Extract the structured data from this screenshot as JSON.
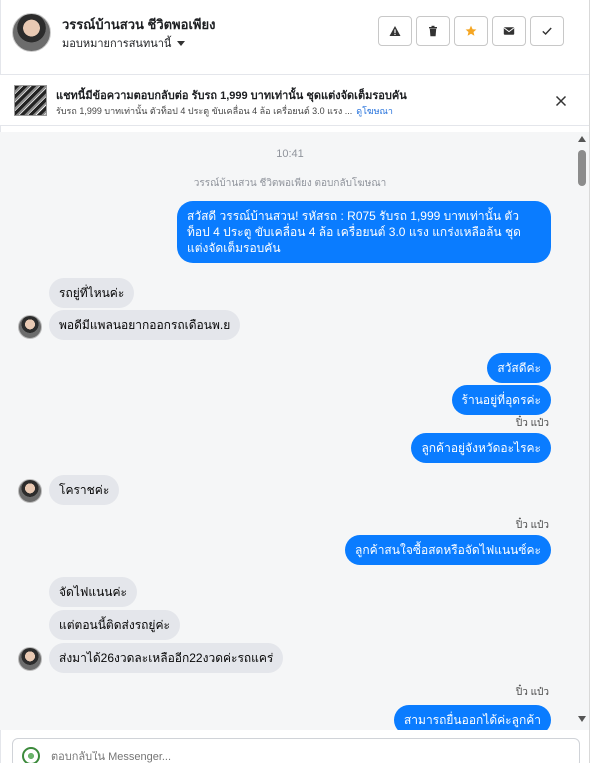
{
  "header": {
    "contact_name": "วรรณ์บ้านสวน ชีวิตพอเพียง",
    "assign_label": "มอบหมายการสนทนานี้",
    "actions": [
      {
        "name": "spam-report",
        "icon": "warning-icon"
      },
      {
        "name": "delete",
        "icon": "trash-icon"
      },
      {
        "name": "star",
        "icon": "star-icon",
        "color": "#f5a623"
      },
      {
        "name": "mark-unread",
        "icon": "envelope-icon"
      },
      {
        "name": "mark-done",
        "icon": "check-icon"
      }
    ]
  },
  "ad_banner": {
    "title": "แชทนี้มีข้อความตอบกลับต่อ รับรถ 1,999 บาทเท่านั้น ชุดแต่งจัดเต็มรอบคัน",
    "subtitle": "รับรถ 1,999 บาทเท่านั้น ตัวท็อป 4 ประตู ขับเคลื่อน 4 ล้อ เครื่อยนต์ 3.0 แรง ...",
    "link_label": "ดูโฆษณา"
  },
  "chat": {
    "timestamp": "10:41",
    "ad_reply_note": "วรรณ์บ้านสวน ชีวิตพอเพียง ตอบกลับโฆษณา",
    "messages": [
      {
        "dir": "out",
        "text": "สวัสดี วรรณ์บ้านสวน! รหัสรถ : R075 รับรถ 1,999 บาทเท่านั้น ตัวท็อป 4 ประตู ขับเคลื่อน 4 ล้อ  เครื่อยนต์ 3.0 แรง แกร่งเหลือล้น ชุดแต่งจัดเต็มรอบคัน"
      },
      {
        "dir": "in",
        "text": "รถยู่ที่ไหนค่ะ"
      },
      {
        "dir": "in",
        "text": "พอดีมีแพลนอยากออกรถเดือนพ.ย"
      },
      {
        "dir": "out",
        "text": "สวัสดีค่ะ"
      },
      {
        "dir": "out",
        "text": "ร้านอยู่ที่อุดรค่ะ"
      },
      {
        "dir": "seen",
        "text": "ปิ๋ว แป๋ว"
      },
      {
        "dir": "out",
        "text": "ลูกค้าอยู่จังหวัดอะไรคะ"
      },
      {
        "dir": "in",
        "text": "โคราชค่ะ"
      },
      {
        "dir": "seen",
        "text": "ปิ๋ว แป๋ว"
      },
      {
        "dir": "out",
        "text": "ลูกค้าสนใจซื้อสดหรือจัดไฟแนนซ์คะ"
      },
      {
        "dir": "in",
        "text": "จัดไฟแนนค่ะ"
      },
      {
        "dir": "in",
        "text": "แต่ตอนนี้ติดส่งรถยู่ค่ะ"
      },
      {
        "dir": "in",
        "text": "ส่งมาได้26งวดละเหลืออีก22งวดค่ะรถแคร่"
      },
      {
        "dir": "seen",
        "text": "ปิ๋ว แป๋ว"
      },
      {
        "dir": "out",
        "text": "สามารถยื่นออกได้ค่ะลูกค้า"
      }
    ]
  },
  "composer": {
    "placeholder": "ตอบกลับใน Messenger..."
  },
  "colors": {
    "outgoing_bubble": "#0a7cff",
    "incoming_bubble": "#e4e6eb",
    "chat_background": "#f5f6f7",
    "link": "#216fdb"
  }
}
